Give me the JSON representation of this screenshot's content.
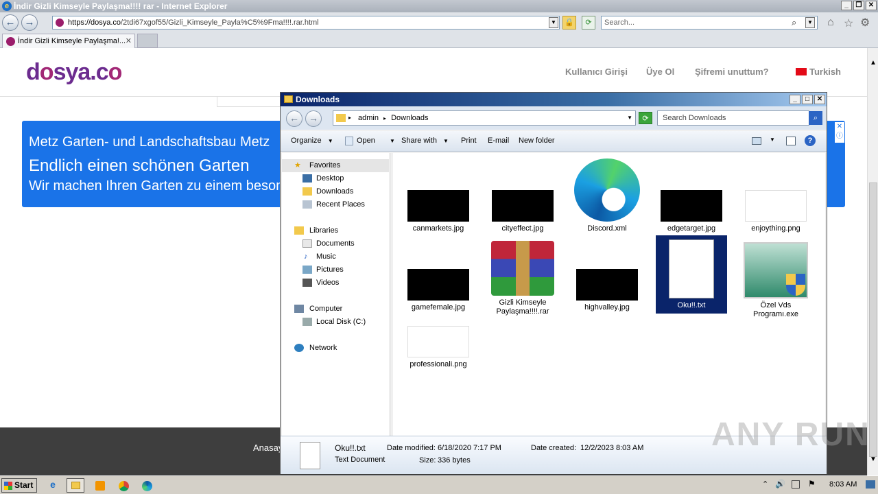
{
  "ie": {
    "title": "İndir Gizli Kimseyle Paylaşma!!!! rar - Internet Explorer",
    "url_prefix": "https://dosya.co",
    "url_path": "/2tdi67xgof55/Gizli_Kimseyle_Payla%C5%9Fma!!!!.rar.html",
    "search_placeholder": "Search...",
    "tab_label": "İndir Gizli Kimseyle Paylaşma!..."
  },
  "site": {
    "logo_a": "d",
    "logo_o": "o",
    "logo_b": "sya.c",
    "logo_c": "o",
    "menu": [
      "Kullanıcı Girişi",
      "Üye Ol",
      "Şifremi unuttum?",
      "Turkish"
    ],
    "banner_line1": "Metz Garten- und Landschaftsbau Metz",
    "banner_line2": "Endlich einen schönen Garten",
    "banner_line3": "Wir machen Ihren Garten zu einem besonderen Ort",
    "footer_link": "Anasayfa"
  },
  "explorer": {
    "title": "Downloads",
    "path": [
      "admin",
      "Downloads"
    ],
    "search_placeholder": "Search Downloads",
    "toolbar": [
      "Organize",
      "Open",
      "Share with",
      "Print",
      "E-mail",
      "New folder"
    ],
    "nav": {
      "favorites": "Favorites",
      "desktop": "Desktop",
      "downloads": "Downloads",
      "recent": "Recent Places",
      "libraries": "Libraries",
      "documents": "Documents",
      "music": "Music",
      "pictures": "Pictures",
      "videos": "Videos",
      "computer": "Computer",
      "local_disk": "Local Disk (C:)",
      "network": "Network"
    },
    "files": [
      {
        "name": "canmarkets.jpg"
      },
      {
        "name": "cityeffect.jpg"
      },
      {
        "name": "Discord.xml"
      },
      {
        "name": "edgetarget.jpg"
      },
      {
        "name": "enjoything.png"
      },
      {
        "name": "gamefemale.jpg"
      },
      {
        "name": "Gizli Kimseyle Paylaşma!!!!.rar"
      },
      {
        "name": "highvalley.jpg"
      },
      {
        "name": "Oku!!.txt"
      },
      {
        "name": "Özel Vds Programı.exe"
      },
      {
        "name": "professionali.png"
      }
    ],
    "details": {
      "name": "Oku!!.txt",
      "type": "Text Document",
      "modified_label": "Date modified:",
      "modified": "6/18/2020 7:17 PM",
      "created_label": "Date created:",
      "created": "12/2/2023 8:03 AM",
      "size_label": "Size:",
      "size": "336 bytes"
    }
  },
  "taskbar": {
    "start": "Start",
    "time": "8:03 AM"
  },
  "watermark": "ANY RUN"
}
